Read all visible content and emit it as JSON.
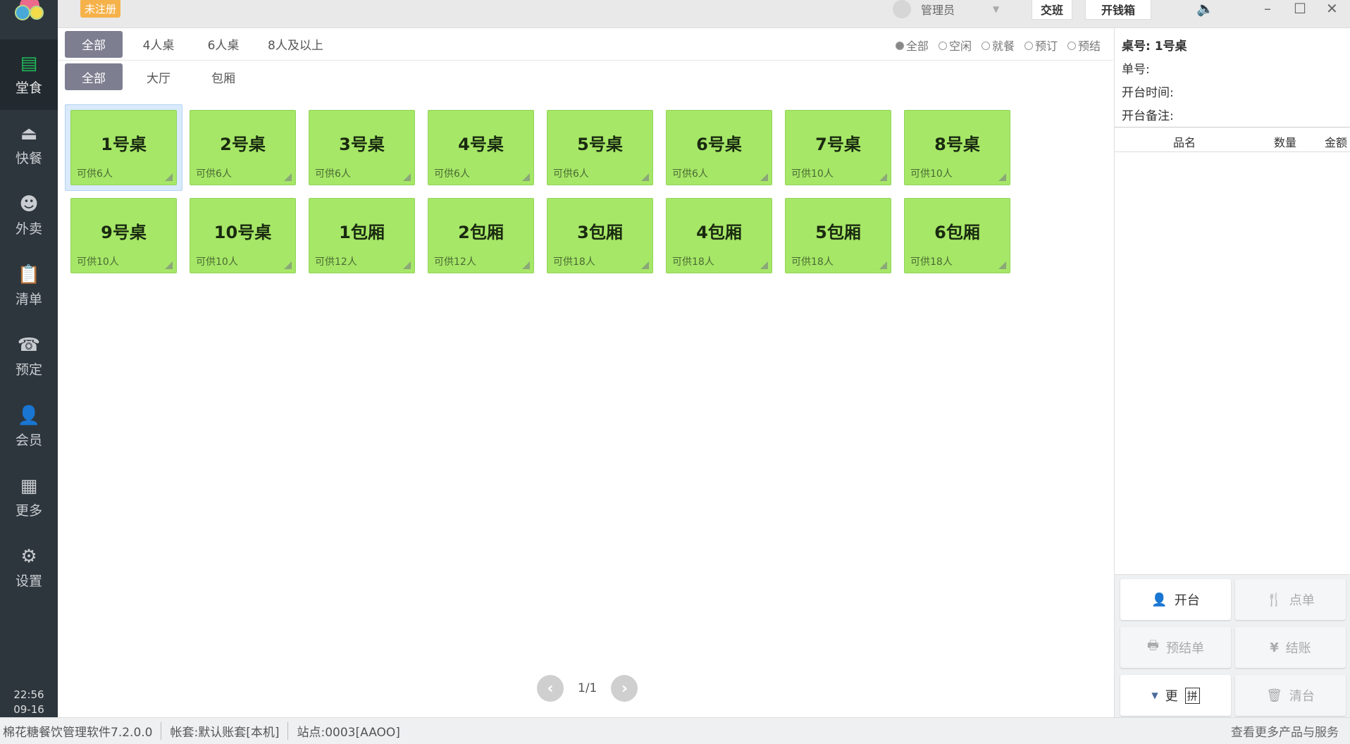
{
  "app": {
    "unregistered": "未注册",
    "user": "管理员",
    "shift_btn": "交班",
    "cashbox_btn": "开钱箱"
  },
  "sidebar": [
    {
      "label": "堂食",
      "icon": "store-icon"
    },
    {
      "label": "快餐",
      "icon": "cloche-icon"
    },
    {
      "label": "外卖",
      "icon": "delivery-icon"
    },
    {
      "label": "清单",
      "icon": "clipboard-icon"
    },
    {
      "label": "预定",
      "icon": "phone-icon"
    },
    {
      "label": "会员",
      "icon": "member-icon"
    },
    {
      "label": "更多",
      "icon": "grid-icon"
    },
    {
      "label": "设置",
      "icon": "gear-icon"
    }
  ],
  "clock": {
    "time": "22:56",
    "date": "09-16"
  },
  "size_filters": [
    "全部",
    "4人桌",
    "6人桌",
    "8人及以上"
  ],
  "area_filters": [
    "全部",
    "大厅",
    "包厢"
  ],
  "status_filters": [
    "全部",
    "空闲",
    "就餐",
    "预订",
    "预结"
  ],
  "tables": [
    {
      "name": "1号桌",
      "cap": "可供6人"
    },
    {
      "name": "2号桌",
      "cap": "可供6人"
    },
    {
      "name": "3号桌",
      "cap": "可供6人"
    },
    {
      "name": "4号桌",
      "cap": "可供6人"
    },
    {
      "name": "5号桌",
      "cap": "可供6人"
    },
    {
      "name": "6号桌",
      "cap": "可供6人"
    },
    {
      "name": "7号桌",
      "cap": "可供10人"
    },
    {
      "name": "8号桌",
      "cap": "可供10人"
    },
    {
      "name": "9号桌",
      "cap": "可供10人"
    },
    {
      "name": "10号桌",
      "cap": "可供10人"
    },
    {
      "name": "1包厢",
      "cap": "可供12人"
    },
    {
      "name": "2包厢",
      "cap": "可供12人"
    },
    {
      "name": "3包厢",
      "cap": "可供18人"
    },
    {
      "name": "4包厢",
      "cap": "可供18人"
    },
    {
      "name": "5包厢",
      "cap": "可供18人"
    },
    {
      "name": "6包厢",
      "cap": "可供18人"
    }
  ],
  "pager": "1/1",
  "detail": {
    "table": "桌号: 1号桌",
    "order_no": "单号:",
    "open_time": "开台时间:",
    "note": "开台备注:",
    "cols": [
      "品名",
      "数量",
      "金额"
    ]
  },
  "actions": {
    "open": "开台",
    "order": "点单",
    "prebill": "预结单",
    "checkout": "结账",
    "more": "更",
    "ime": "拼",
    "clear": "清台"
  },
  "statusbar": {
    "version": "棉花糖餐饮管理软件7.2.0.0",
    "account": "帐套:默认账套[本机]",
    "station": "站点:0003[AAOO]",
    "more": "查看更多产品与服务"
  }
}
